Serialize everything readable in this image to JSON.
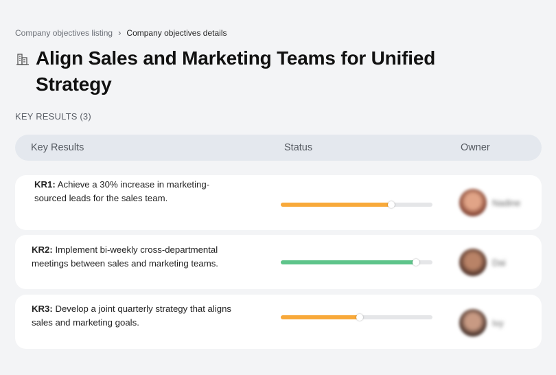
{
  "breadcrumb": {
    "parent": "Company objectives listing",
    "separator": "›",
    "current": "Company objectives details"
  },
  "page_title": "Align Sales and Marketing Teams for Unified Strategy",
  "title_icon": "building-icon",
  "section_label": "KEY RESULTS (3)",
  "table": {
    "headers": {
      "key_results": "Key Results",
      "status": "Status",
      "owner": "Owner"
    },
    "rows": [
      {
        "kr_label": "KR1:",
        "description": "Achieve a 30% increase in marketing-sourced leads for the sales team.",
        "progress": 0.73,
        "progress_color": "#f8a93a",
        "owner_name": "Nadine",
        "avatar_colors": [
          "#7a3a2a",
          "#e1a487"
        ]
      },
      {
        "kr_label": "KR2:",
        "description": "Implement bi-weekly cross-departmental meetings between sales and marketing teams.",
        "progress": 0.89,
        "progress_color": "#5ec48a",
        "owner_name": "Dai",
        "avatar_colors": [
          "#4a2d24",
          "#b98367"
        ]
      },
      {
        "kr_label": "KR3:",
        "description": "Develop a joint quarterly strategy that aligns sales and marketing goals.",
        "progress": 0.52,
        "progress_color": "#f8a93a",
        "owner_name": "Ivy",
        "avatar_colors": [
          "#3b2620",
          "#c89a83"
        ]
      }
    ]
  }
}
